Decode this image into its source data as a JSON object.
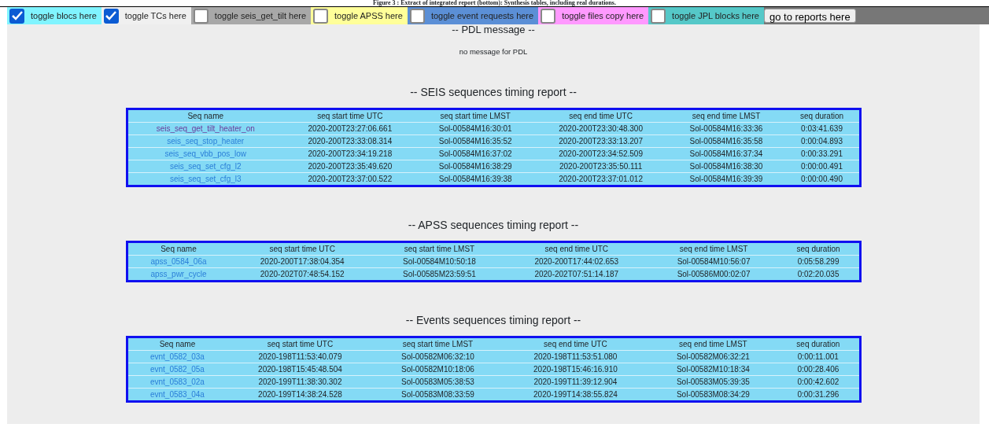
{
  "caption": "Figure 3 : Extract of integrated report (bottom): Synthesis tables, including real durations.",
  "toggles": [
    {
      "label": "toggle blocs here",
      "checked": true,
      "color": "#80f4ff"
    },
    {
      "label": "toggle TCs here",
      "checked": true,
      "color": "#f0f0f0"
    },
    {
      "label": "toggle seis_get_tilt here",
      "checked": false,
      "color": "#a8a8a8"
    },
    {
      "label": "toggle APSS here",
      "checked": false,
      "color": "#ffff99"
    },
    {
      "label": "toggle event requests here",
      "checked": false,
      "color": "#5b8fd6"
    },
    {
      "label": "toggle files copy here",
      "checked": false,
      "color": "#ff99ff"
    },
    {
      "label": "toggle JPL blocks here",
      "checked": false,
      "color": "#55c8c8"
    }
  ],
  "reports_button": "go to reports here",
  "pdl": {
    "title": "-- PDL message --",
    "message": "no message for PDL"
  },
  "reports": [
    {
      "title": "-- SEIS sequences timing report --",
      "columns": [
        "Seq name",
        "seq start time UTC",
        "seq start time LMST",
        "seq end time UTC",
        "seq end time LMST",
        "seq duration"
      ],
      "rows": [
        {
          "visited": true,
          "cells": [
            "seis_seq_get_tilt_heater_on",
            "2020-200T23:27:06.661",
            "Sol-00584M16:30:01",
            "2020-200T23:30:48.300",
            "Sol-00584M16:33:36",
            "0:03:41.639"
          ]
        },
        {
          "visited": false,
          "cells": [
            "seis_seq_stop_heater",
            "2020-200T23:33:08.314",
            "Sol-00584M16:35:52",
            "2020-200T23:33:13.207",
            "Sol-00584M16:35:58",
            "0:00:04.893"
          ]
        },
        {
          "visited": false,
          "cells": [
            "seis_seq_vbb_pos_low",
            "2020-200T23:34:19.218",
            "Sol-00584M16:37:02",
            "2020-200T23:34:52.509",
            "Sol-00584M16:37:34",
            "0:00:33.291"
          ]
        },
        {
          "visited": false,
          "cells": [
            "seis_seq_set_cfg_l2",
            "2020-200T23:35:49.620",
            "Sol-00584M16:38:29",
            "2020-200T23:35:50.111",
            "Sol-00584M16:38:30",
            "0:00:00.491"
          ]
        },
        {
          "visited": false,
          "cells": [
            "seis_seq_set_cfg_l3",
            "2020-200T23:37:00.522",
            "Sol-00584M16:39:38",
            "2020-200T23:37:01.012",
            "Sol-00584M16:39:39",
            "0:00:00.490"
          ]
        }
      ]
    },
    {
      "title": "-- APSS sequences timing report --",
      "columns": [
        "Seq name",
        "seq start time UTC",
        "seq start time LMST",
        "seq end time UTC",
        "seq end time LMST",
        "seq duration"
      ],
      "rows": [
        {
          "visited": false,
          "cells": [
            "apss_0584_06a",
            "2020-200T17:38:04.354",
            "Sol-00584M10:50:18",
            "2020-200T17:44:02.653",
            "Sol-00584M10:56:07",
            "0:05:58.299"
          ]
        },
        {
          "visited": false,
          "cells": [
            "apss_pwr_cycle",
            "2020-202T07:48:54.152",
            "Sol-00585M23:59:51",
            "2020-202T07:51:14.187",
            "Sol-00586M00:02:07",
            "0:02:20.035"
          ]
        }
      ]
    },
    {
      "title": "-- Events sequences timing report --",
      "columns": [
        "Seq name",
        "seq start time UTC",
        "seq start time LMST",
        "seq end time UTC",
        "seq end time LMST",
        "seq duration"
      ],
      "rows": [
        {
          "visited": false,
          "cells": [
            "evnt_0582_03a",
            "2020-198T11:53:40.079",
            "Sol-00582M06:32:10",
            "2020-198T11:53:51.080",
            "Sol-00582M06:32:21",
            "0:00:11.001"
          ]
        },
        {
          "visited": false,
          "cells": [
            "evnt_0582_05a",
            "2020-198T15:45:48.504",
            "Sol-00582M10:18:06",
            "2020-198T15:46:16.910",
            "Sol-00582M10:18:34",
            "0:00:28.406"
          ]
        },
        {
          "visited": false,
          "cells": [
            "evnt_0583_02a",
            "2020-199T11:38:30.302",
            "Sol-00583M05:38:53",
            "2020-199T11:39:12.904",
            "Sol-00583M05:39:35",
            "0:00:42.602"
          ]
        },
        {
          "visited": false,
          "cells": [
            "evnt_0583_04a",
            "2020-199T14:38:24.528",
            "Sol-00583M08:33:59",
            "2020-199T14:38:55.824",
            "Sol-00583M08:34:29",
            "0:00:31.296"
          ]
        }
      ]
    }
  ]
}
